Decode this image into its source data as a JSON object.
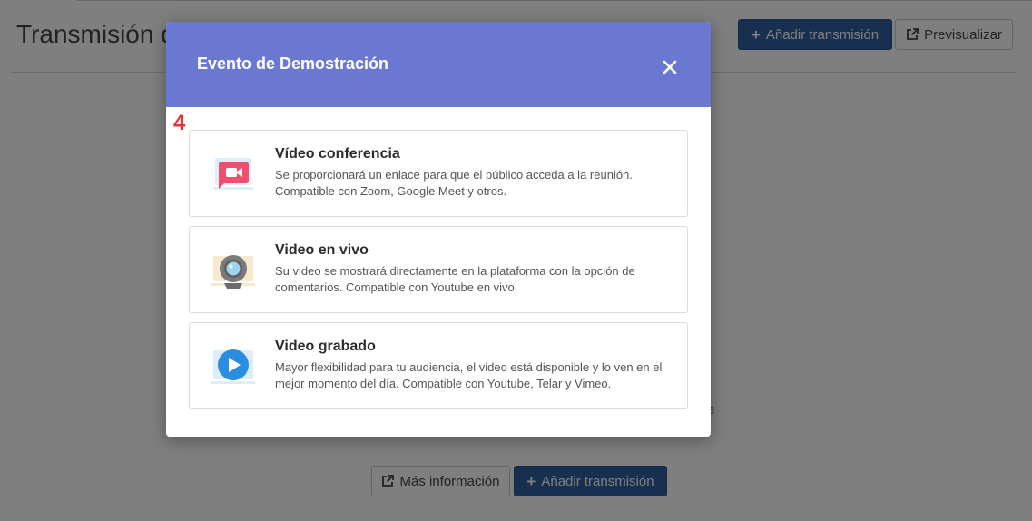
{
  "page": {
    "title": "Transmisión de",
    "add_stream_label": "Añadir transmisión",
    "preview_label": "Previsualizar",
    "more_info_label": "Más información",
    "add_stream_bottom_label": "Añadir transmisión",
    "stray_text": "a"
  },
  "icons": {
    "plus": "+",
    "external_link": "external-link-icon",
    "close": "close-icon"
  },
  "modal": {
    "title": "Evento de Demostración",
    "step_number": "4",
    "options": [
      {
        "title": "Vídeo conferencia",
        "description": "Se proporcionará un enlace para que el público acceda a la reunión. Compatible con Zoom, Google Meet y otros.",
        "icon": "video-conference-icon"
      },
      {
        "title": "Video en vivo",
        "description": "Su video se mostrará directamente en la plataforma con la opción de comentarios. Compatible con Youtube en vivo.",
        "icon": "webcam-icon"
      },
      {
        "title": "Video grabado",
        "description": "Mayor flexibilidad para tu audiencia, el video está disponible y lo ven en el mejor momento del día. Compatible con Youtube, Telar y Vimeo.",
        "icon": "play-icon"
      }
    ]
  },
  "colors": {
    "header": "#6a78d1",
    "primary": "#31609e",
    "step_number": "#e63232",
    "icon_pink": "#f0506e",
    "icon_blue": "#2a8de0"
  }
}
